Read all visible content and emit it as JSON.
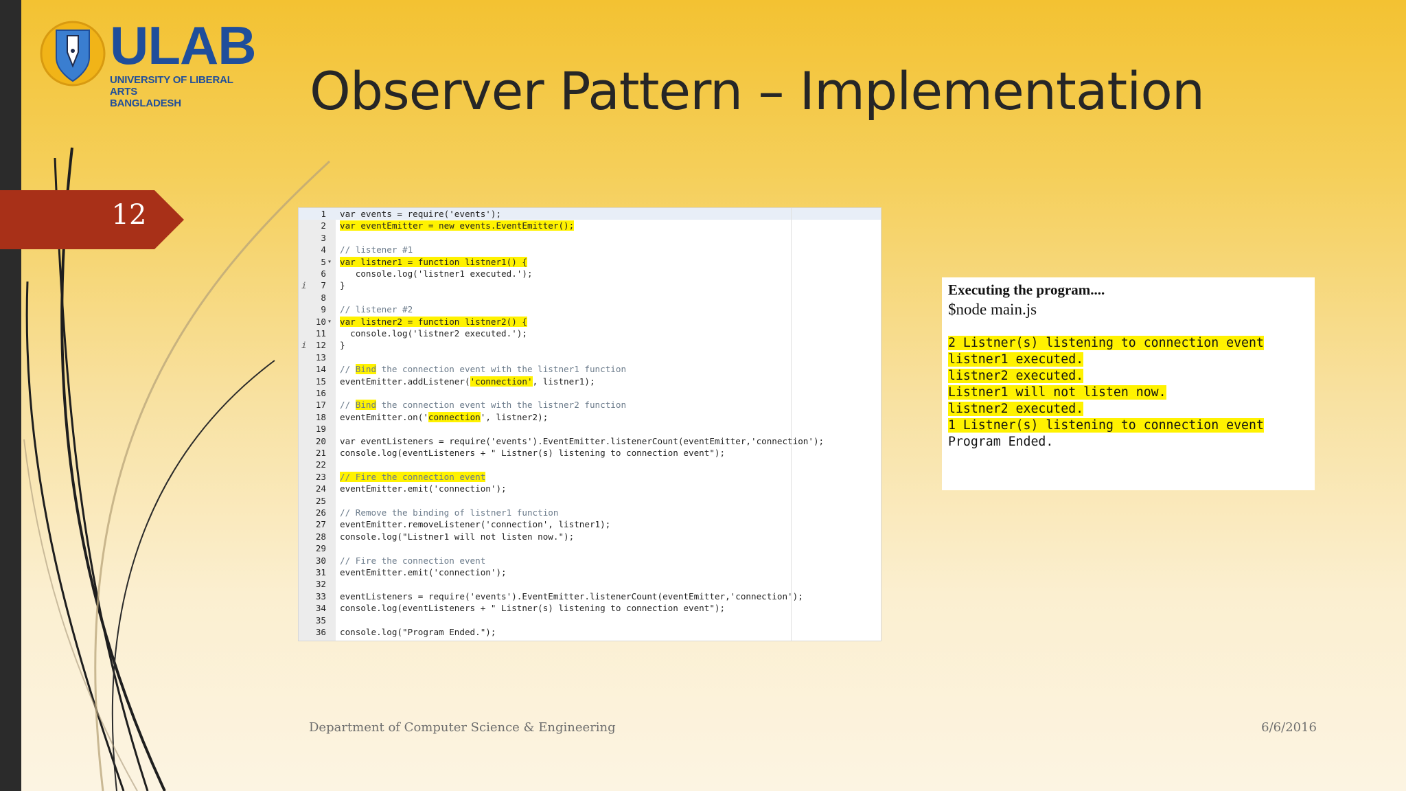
{
  "logo": {
    "name": "ULAB",
    "subtitle_line1": "UNIVERSITY OF LIBERAL ARTS",
    "subtitle_line2": "BANGLADESH"
  },
  "slide": {
    "title": "Observer Pattern – Implementation",
    "number": "12"
  },
  "code": {
    "lines": [
      {
        "n": "1",
        "text": "var events = require('events');"
      },
      {
        "n": "2",
        "text": "var eventEmitter = new events.EventEmitter();"
      },
      {
        "n": "3",
        "text": ""
      },
      {
        "n": "4",
        "text": "// listener #1"
      },
      {
        "n": "5",
        "text": "var listner1 = function listner1() {"
      },
      {
        "n": "6",
        "text": "   console.log('listner1 executed.');"
      },
      {
        "n": "7",
        "text": "}"
      },
      {
        "n": "8",
        "text": ""
      },
      {
        "n": "9",
        "text": "// listener #2"
      },
      {
        "n": "10",
        "text": "var listner2 = function listner2() {"
      },
      {
        "n": "11",
        "text": "  console.log('listner2 executed.');"
      },
      {
        "n": "12",
        "text": "}"
      },
      {
        "n": "13",
        "text": ""
      },
      {
        "n": "14",
        "text": "// Bind the connection event with the listner1 function"
      },
      {
        "n": "15",
        "text": "eventEmitter.addListener('connection', listner1);"
      },
      {
        "n": "16",
        "text": ""
      },
      {
        "n": "17",
        "text": "// Bind the connection event with the listner2 function"
      },
      {
        "n": "18",
        "text": "eventEmitter.on('connection', listner2);"
      },
      {
        "n": "19",
        "text": ""
      },
      {
        "n": "20",
        "text": "var eventListeners = require('events').EventEmitter.listenerCount(eventEmitter,'connection');"
      },
      {
        "n": "21",
        "text": "console.log(eventListeners + \" Listner(s) listening to connection event\");"
      },
      {
        "n": "22",
        "text": ""
      },
      {
        "n": "23",
        "text": "// Fire the connection event"
      },
      {
        "n": "24",
        "text": "eventEmitter.emit('connection');"
      },
      {
        "n": "25",
        "text": ""
      },
      {
        "n": "26",
        "text": "// Remove the binding of listner1 function"
      },
      {
        "n": "27",
        "text": "eventEmitter.removeListener('connection', listner1);"
      },
      {
        "n": "28",
        "text": "console.log(\"Listner1 will not listen now.\");"
      },
      {
        "n": "29",
        "text": ""
      },
      {
        "n": "30",
        "text": "// Fire the connection event"
      },
      {
        "n": "31",
        "text": "eventEmitter.emit('connection');"
      },
      {
        "n": "32",
        "text": ""
      },
      {
        "n": "33",
        "text": "eventListeners = require('events').EventEmitter.listenerCount(eventEmitter,'connection');"
      },
      {
        "n": "34",
        "text": "console.log(eventListeners + \" Listner(s) listening to connection event\");"
      },
      {
        "n": "35",
        "text": ""
      },
      {
        "n": "36",
        "text": "console.log(\"Program Ended.\");"
      }
    ]
  },
  "output": {
    "heading": "Executing the program....",
    "command": "$node main.js",
    "lines": [
      "2 Listner(s) listening to connection event",
      "listner1 executed.",
      "listner2 executed.",
      "Listner1 will not listen now.",
      "listner2 executed.",
      "1 Listner(s) listening to connection event",
      "Program Ended."
    ]
  },
  "footer": {
    "department": "Department of Computer Science & Engineering",
    "date": "6/6/2016"
  },
  "colors": {
    "highlight": "#fff200",
    "tag": "#a83018",
    "logo_blue": "#1f4e9b"
  }
}
